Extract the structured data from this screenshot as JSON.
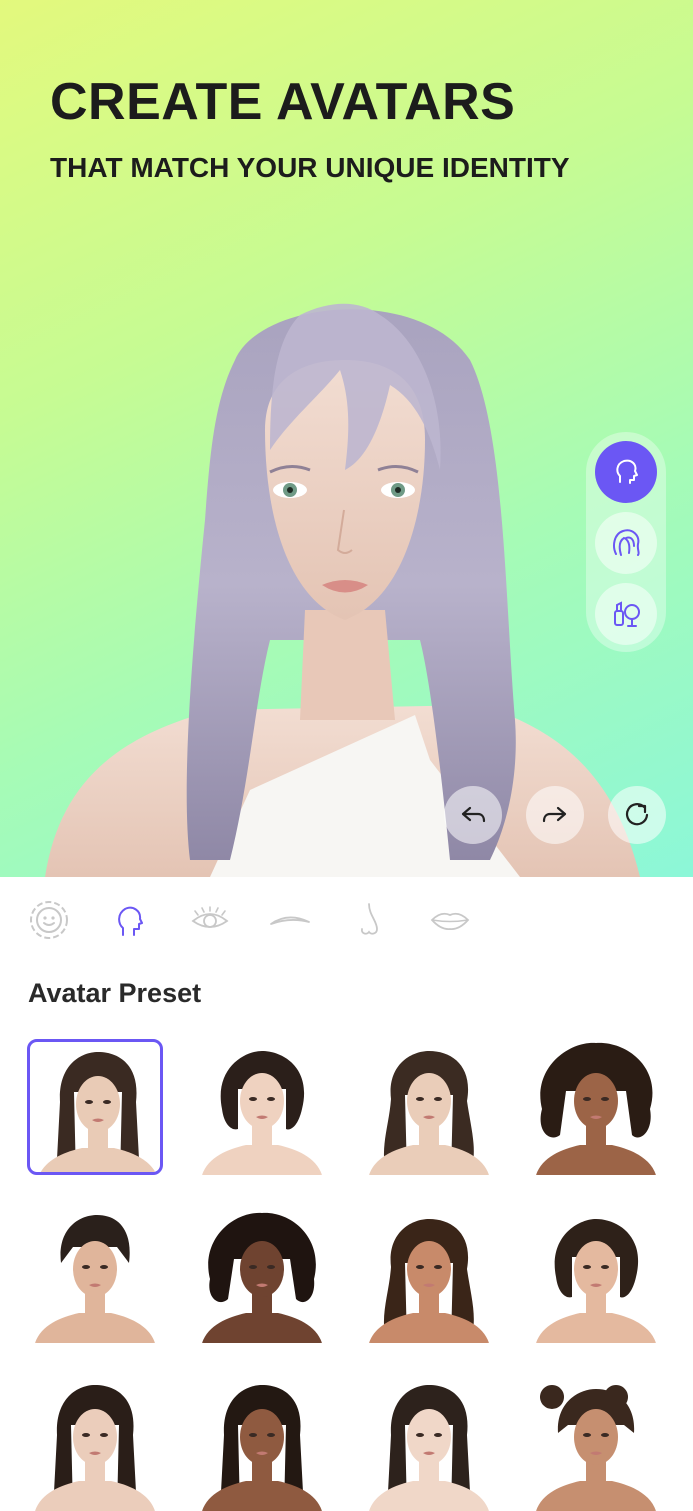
{
  "hero": {
    "headline": "CREATE AVATARS",
    "subline": "THAT MATCH YOUR UNIQUE IDENTITY"
  },
  "side_tools": [
    {
      "name": "head",
      "icon": "head-profile-icon",
      "active": true
    },
    {
      "name": "hair",
      "icon": "hair-icon",
      "active": false
    },
    {
      "name": "makeup",
      "icon": "makeup-icon",
      "active": false
    }
  ],
  "controls": {
    "undo": "undo-icon",
    "redo": "redo-icon",
    "reset": "reset-icon"
  },
  "feature_tabs": [
    {
      "name": "face",
      "icon": "face-icon",
      "active": false
    },
    {
      "name": "head-shape",
      "icon": "head-shape-icon",
      "active": true
    },
    {
      "name": "eyes",
      "icon": "eye-icon",
      "active": false
    },
    {
      "name": "eyebrows",
      "icon": "eyebrow-icon",
      "active": false
    },
    {
      "name": "nose",
      "icon": "nose-icon",
      "active": false
    },
    {
      "name": "lips",
      "icon": "lips-icon",
      "active": false
    }
  ],
  "preset_section": {
    "title": "Avatar Preset"
  },
  "presets": [
    {
      "hair": "long-straight",
      "hair_color": "#3a2a22",
      "skin": "#e9cbb6",
      "selected": true
    },
    {
      "hair": "bob",
      "hair_color": "#2b1f1a",
      "skin": "#efd2c0",
      "selected": false
    },
    {
      "hair": "long-wavy",
      "hair_color": "#3b2b22",
      "skin": "#eacdb9",
      "selected": false
    },
    {
      "hair": "afro-curly",
      "hair_color": "#2a1c14",
      "skin": "#9c6447",
      "selected": false
    },
    {
      "hair": "short-fringe",
      "hair_color": "#2a201b",
      "skin": "#e0b59b",
      "selected": false
    },
    {
      "hair": "curly",
      "hair_color": "#1f1410",
      "skin": "#6f4330",
      "selected": false
    },
    {
      "hair": "long-wavy",
      "hair_color": "#3a2518",
      "skin": "#c88a6a",
      "selected": false
    },
    {
      "hair": "bob",
      "hair_color": "#2e2119",
      "skin": "#e4b99f",
      "selected": false
    },
    {
      "hair": "long-straight",
      "hair_color": "#2a1e18",
      "skin": "#ebcdbb",
      "selected": false
    },
    {
      "hair": "long-straight",
      "hair_color": "#231812",
      "skin": "#8f5a40",
      "selected": false
    },
    {
      "hair": "long-straight",
      "hair_color": "#2d221c",
      "skin": "#f0d7c8",
      "selected": false
    },
    {
      "hair": "buns",
      "hair_color": "#3a281e",
      "skin": "#c68f70",
      "selected": false
    }
  ],
  "colors": {
    "accent": "#6b57f4",
    "main_avatar_hair": "#b5b0c8",
    "main_avatar_skin": "#efd8cc"
  }
}
